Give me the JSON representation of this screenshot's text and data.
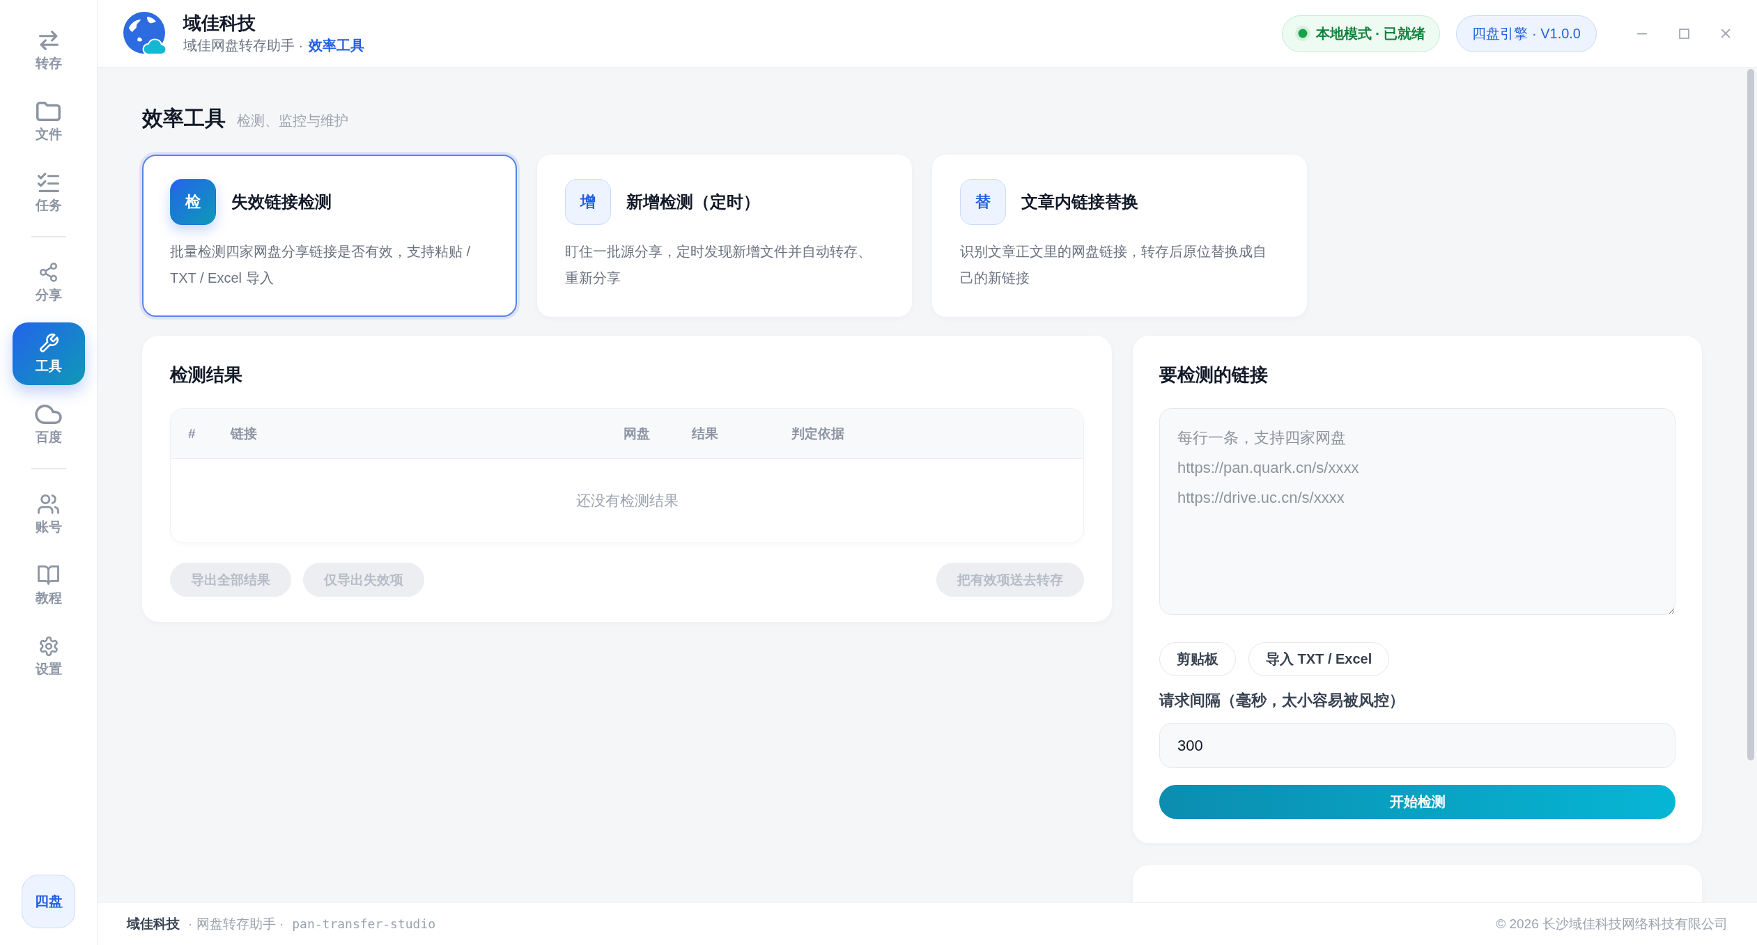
{
  "sidebar": {
    "groups": [
      {
        "items": [
          {
            "label": "转存",
            "selected": false
          },
          {
            "label": "文件",
            "selected": false
          },
          {
            "label": "任务",
            "selected": false
          }
        ]
      },
      {
        "items": [
          {
            "label": "分享",
            "selected": false
          },
          {
            "label": "工具",
            "selected": true
          },
          {
            "label": "百度",
            "selected": false
          }
        ]
      },
      {
        "items": [
          {
            "label": "账号",
            "selected": false
          },
          {
            "label": "教程",
            "selected": false
          },
          {
            "label": "设置",
            "selected": false
          }
        ]
      }
    ],
    "badge": "四盘"
  },
  "header": {
    "title": "域佳科技",
    "subtitle": "域佳网盘转存助手 ·",
    "current_page": "效率工具",
    "status": "本地模式 · 已就绪",
    "version": "四盘引擎 · V1.0.0"
  },
  "page": {
    "title": "效率工具",
    "subtitle": "检测、监控与维护"
  },
  "tools": [
    {
      "badge": "检",
      "title": "失效链接检测",
      "description": "批量检测四家网盘分享链接是否有效，支持粘贴 / TXT / Excel 导入",
      "selected": true
    },
    {
      "badge": "增",
      "title": "新增检测（定时）",
      "description": "盯住一批源分享，定时发现新增文件并自动转存、重新分享",
      "selected": false
    },
    {
      "badge": "替",
      "title": "文章内链接替换",
      "description": "识别文章正文里的网盘链接，转存后原位替换成自己的新链接",
      "selected": false
    }
  ],
  "results": {
    "title": "检测结果",
    "columns": [
      "#",
      "链接",
      "网盘",
      "结果",
      "判定依据"
    ],
    "empty_text": "还没有检测结果",
    "actions": [
      {
        "label": "导出全部结果",
        "disabled": true
      },
      {
        "label": "仅导出失效项",
        "disabled": true
      },
      {
        "label": "把有效项送去转存",
        "disabled": true
      }
    ]
  },
  "input_panel": {
    "title": "要检测的链接",
    "links_field": {
      "placeholder": "每行一条，支持四家网盘\nhttps://pan.quark.cn/s/xxxx\nhttps://drive.uc.cn/s/xxxx"
    },
    "source_buttons": [
      "剪贴板",
      "导入 TXT / Excel"
    ],
    "interval": {
      "label": "请求间隔（毫秒，太小容易被风控）",
      "value": "300"
    },
    "start_button": "开始检测"
  },
  "footer": {
    "brand": "域佳科技",
    "product": "· 网盘转存助手 ·",
    "project": "pan-transfer-studio",
    "copyright": "© 2026 长沙域佳科技网络科技有限公司"
  }
}
